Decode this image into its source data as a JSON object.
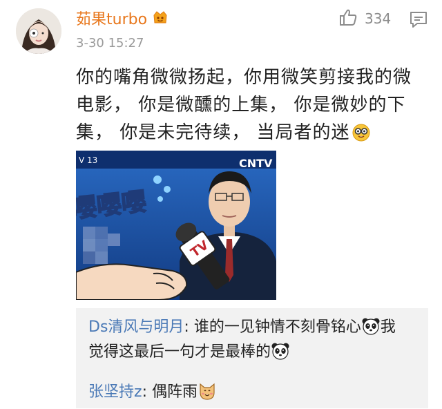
{
  "post": {
    "username": "茹果turbo",
    "timestamp": "3-30 15:27",
    "like_count": "334",
    "text_line1": "你的嘴角微微扬起，你用微笑剪接我的微",
    "text_line2": "电影， 你是微醺的上集， 你是微妙的下",
    "text_line3": "集， 你是未完待续， 当局者的迷"
  },
  "image": {
    "channel_logo": "CNTV",
    "mic_label": "TV",
    "overlay_text": "嘤嘤嘤",
    "corner_tag": "V 13"
  },
  "replies": [
    {
      "author": "Ds清风与明月",
      "separator": ":",
      "text_part1": " 谁的一见钟情不刻骨铭心",
      "text_part2": "我",
      "text_part3": "觉得这最后一句才是最棒的"
    },
    {
      "author": "张坚持z",
      "separator": ":",
      "text_part1": " 偶阵雨"
    }
  ],
  "icons": {
    "vip": "crown-badge-icon",
    "like": "thumbs-up-icon",
    "comment": "comment-icon",
    "nerd_emoji": "nerd-face-emoji",
    "panda_emoji": "panda-emoji",
    "cat_emoji": "cat-emoji"
  },
  "colors": {
    "username": "#e8771c",
    "reply_author": "#4a79b6",
    "reply_bg": "#f2f2f2",
    "meta": "#9a9a9a"
  }
}
